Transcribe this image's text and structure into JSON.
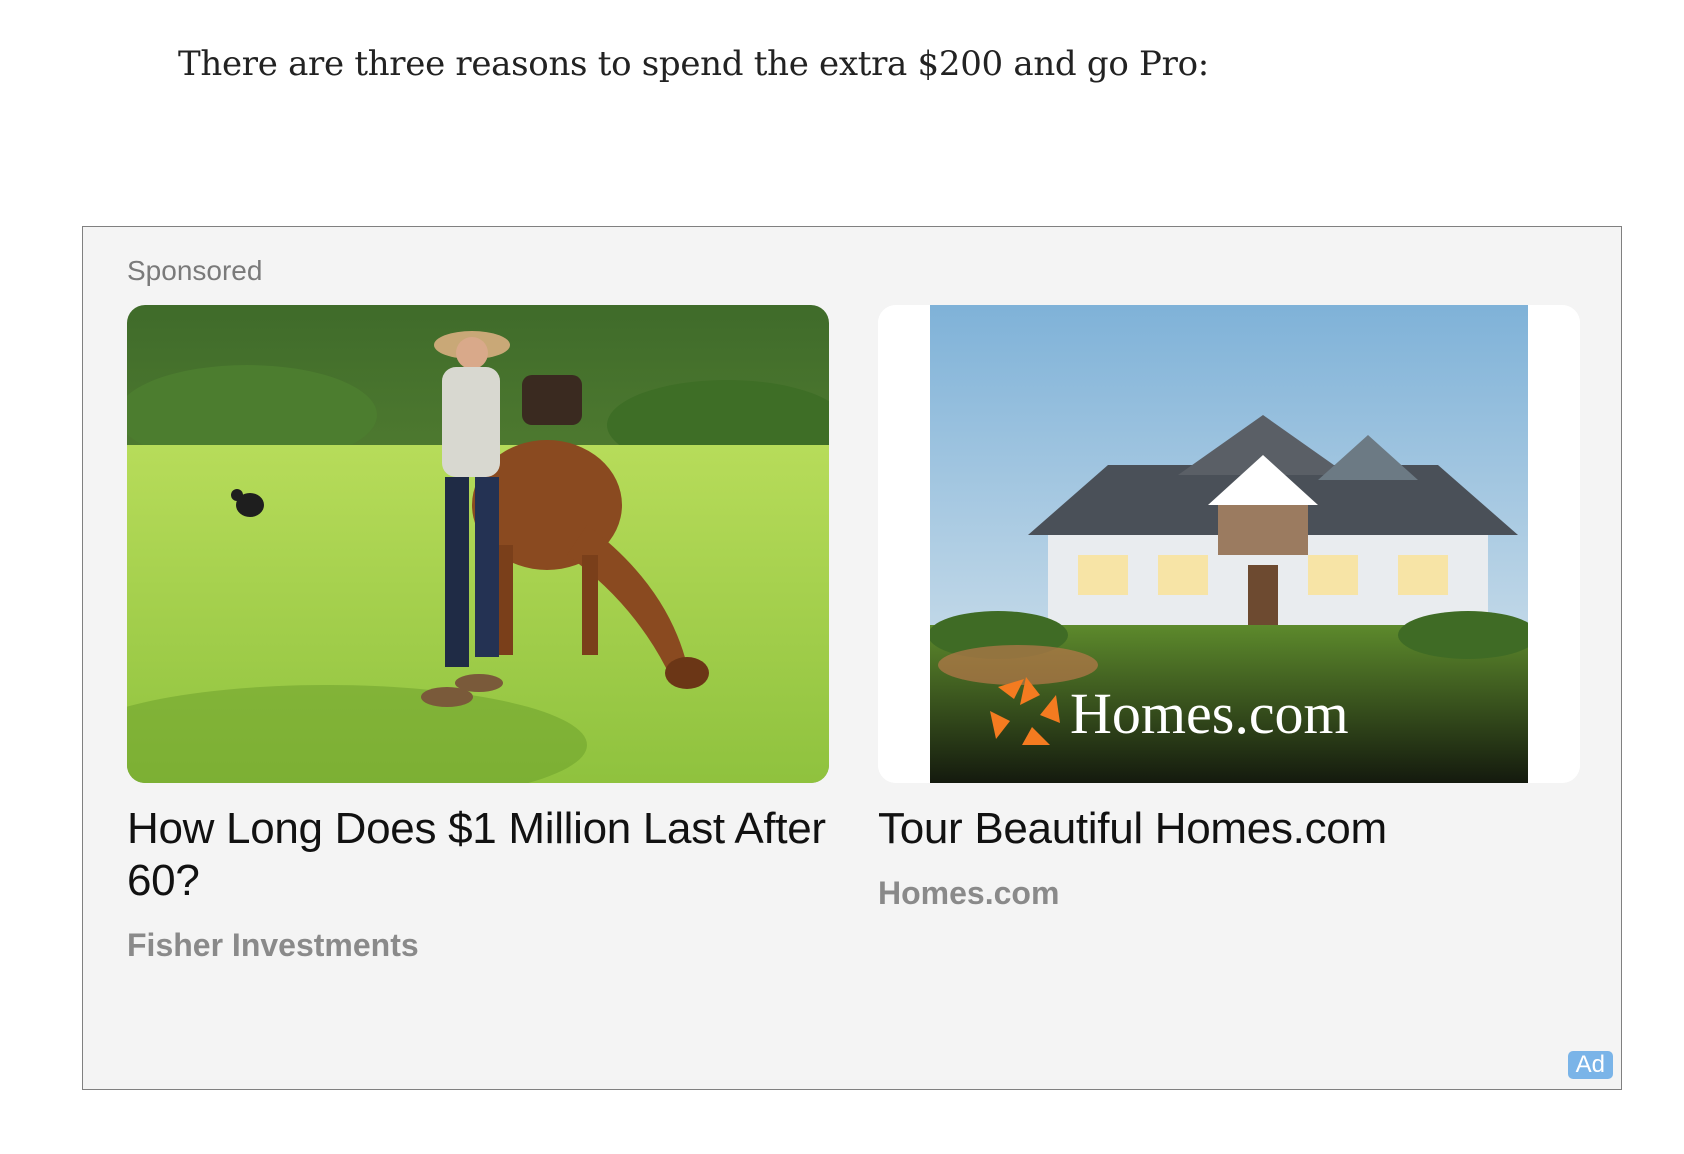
{
  "article": {
    "text": "There are three reasons to spend the extra $200 and go Pro:"
  },
  "ad": {
    "sponsored_label": "Sponsored",
    "badge": "Ad",
    "cards": [
      {
        "title": "How Long Does $1 Million Last After 60?",
        "source": "Fisher Investments",
        "image": "man-with-horse-in-meadow"
      },
      {
        "title": "Tour Beautiful Homes.com",
        "source": "Homes.com",
        "image": "house-with-homes-logo",
        "logo_text": "Homes.com"
      }
    ]
  },
  "colors": {
    "logo_orange": "#f47b20",
    "ad_badge": "#7ab4e8"
  }
}
